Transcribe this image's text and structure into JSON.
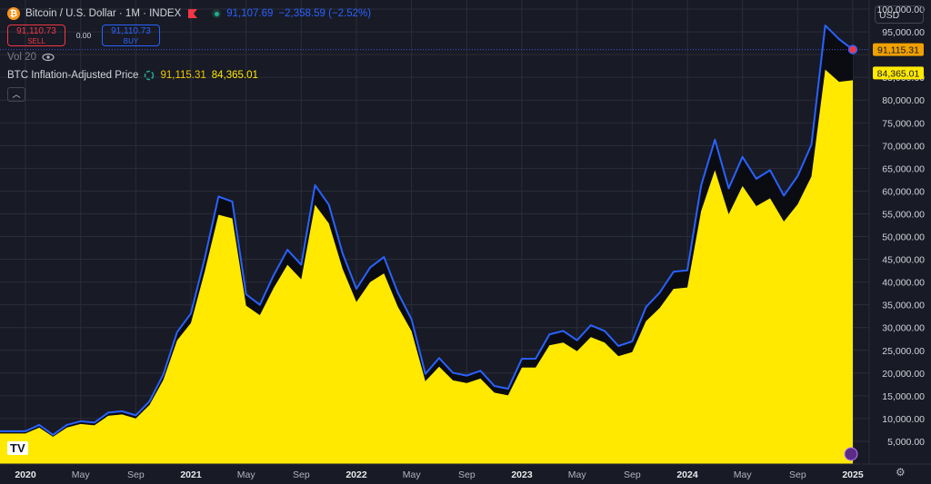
{
  "header": {
    "symbol_title": "Bitcoin / U.S. Dollar · 1M · INDEX",
    "last_price": "91,107.69",
    "change": "−2,358.59 (−2.52%)",
    "sell_price": "91,110.73",
    "sell_label": "SELL",
    "spread": "0.00",
    "buy_price": "91,110.73",
    "buy_label": "BUY",
    "volume_label": "Vol 20",
    "indicator_name": "BTC Inflation-Adjusted Price",
    "indicator_value_1": "91,115.31",
    "indicator_value_2": "84,365.01",
    "collapse_icon": "chevron-up-icon"
  },
  "currency": "USD",
  "chart_data": {
    "type": "area",
    "title": "Bitcoin / U.S. Dollar · 1M · INDEX",
    "x": [
      "2020-01",
      "2020-02",
      "2020-03",
      "2020-04",
      "2020-05",
      "2020-06",
      "2020-07",
      "2020-08",
      "2020-09",
      "2020-10",
      "2020-11",
      "2020-12",
      "2021-01",
      "2021-02",
      "2021-03",
      "2021-04",
      "2021-05",
      "2021-06",
      "2021-07",
      "2021-08",
      "2021-09",
      "2021-10",
      "2021-11",
      "2021-12",
      "2022-01",
      "2022-02",
      "2022-03",
      "2022-04",
      "2022-05",
      "2022-06",
      "2022-07",
      "2022-08",
      "2022-09",
      "2022-10",
      "2022-11",
      "2022-12",
      "2023-01",
      "2023-02",
      "2023-03",
      "2023-04",
      "2023-05",
      "2023-06",
      "2023-07",
      "2023-08",
      "2023-09",
      "2023-10",
      "2023-11",
      "2023-12",
      "2024-01",
      "2024-02",
      "2024-03",
      "2024-04",
      "2024-05",
      "2024-06",
      "2024-07",
      "2024-08",
      "2024-09",
      "2024-10",
      "2024-11",
      "2024-12",
      "2025-01"
    ],
    "x_tick_labels": [
      "2020",
      "May",
      "Sep",
      "2021",
      "May",
      "Sep",
      "2022",
      "May",
      "Sep",
      "2023",
      "May",
      "Sep",
      "2024",
      "May",
      "Sep",
      "2025"
    ],
    "series": [
      {
        "name": "Bitcoin / U.S. Dollar",
        "color": "#2962ff",
        "values": [
          7200,
          8600,
          6400,
          8600,
          9400,
          9100,
          11300,
          11600,
          10700,
          13800,
          19700,
          29000,
          33100,
          45200,
          58800,
          57700,
          37300,
          35000,
          41500,
          47100,
          43800,
          61300,
          57000,
          46300,
          38500,
          43200,
          45500,
          37700,
          31800,
          19800,
          23300,
          20050,
          19430,
          20500,
          17170,
          16550,
          23130,
          23150,
          28500,
          29250,
          27200,
          30500,
          29250,
          25950,
          26970,
          34500,
          37700,
          42260,
          42580,
          61200,
          71300,
          60600,
          67500,
          62700,
          64600,
          59000,
          63300,
          70200,
          96400,
          93400,
          91108
        ]
      },
      {
        "name": "BTC Inflation-Adjusted Price",
        "color": "#ffe900",
        "values": [
          6700,
          8000,
          6000,
          8000,
          8800,
          8500,
          10600,
          10900,
          10000,
          13000,
          18500,
          27200,
          31000,
          42300,
          54800,
          54000,
          34800,
          32700,
          38700,
          43800,
          40600,
          57000,
          52900,
          42900,
          35600,
          40000,
          41900,
          34600,
          29200,
          18200,
          21400,
          18400,
          17800,
          18800,
          15700,
          15100,
          21200,
          21200,
          26100,
          26700,
          24800,
          27900,
          26700,
          23700,
          24600,
          31400,
          34300,
          38500,
          38800,
          55600,
          64600,
          54900,
          61100,
          56700,
          58400,
          53300,
          57100,
          63200,
          86700,
          84000,
          84365
        ]
      }
    ],
    "y_ticks": [
      5000,
      10000,
      15000,
      20000,
      25000,
      30000,
      35000,
      40000,
      45000,
      50000,
      55000,
      60000,
      65000,
      70000,
      75000,
      80000,
      85000,
      90000,
      95000,
      100000
    ],
    "y_tick_labels": [
      "5,000.00",
      "10,000.00",
      "15,000.00",
      "20,000.00",
      "25,000.00",
      "30,000.00",
      "35,000.00",
      "40,000.00",
      "45,000.00",
      "50,000.00",
      "55,000.00",
      "60,000.00",
      "65,000.00",
      "70,000.00",
      "75,000.00",
      "80,000.00",
      "85,000.00",
      "90,000.00",
      "95,000.00",
      "100,000.00"
    ],
    "ylim": [
      0,
      102000
    ],
    "price_labels": [
      "91,115.31",
      "84,365.01"
    ],
    "grid": true,
    "xlabel": "",
    "ylabel": ""
  }
}
